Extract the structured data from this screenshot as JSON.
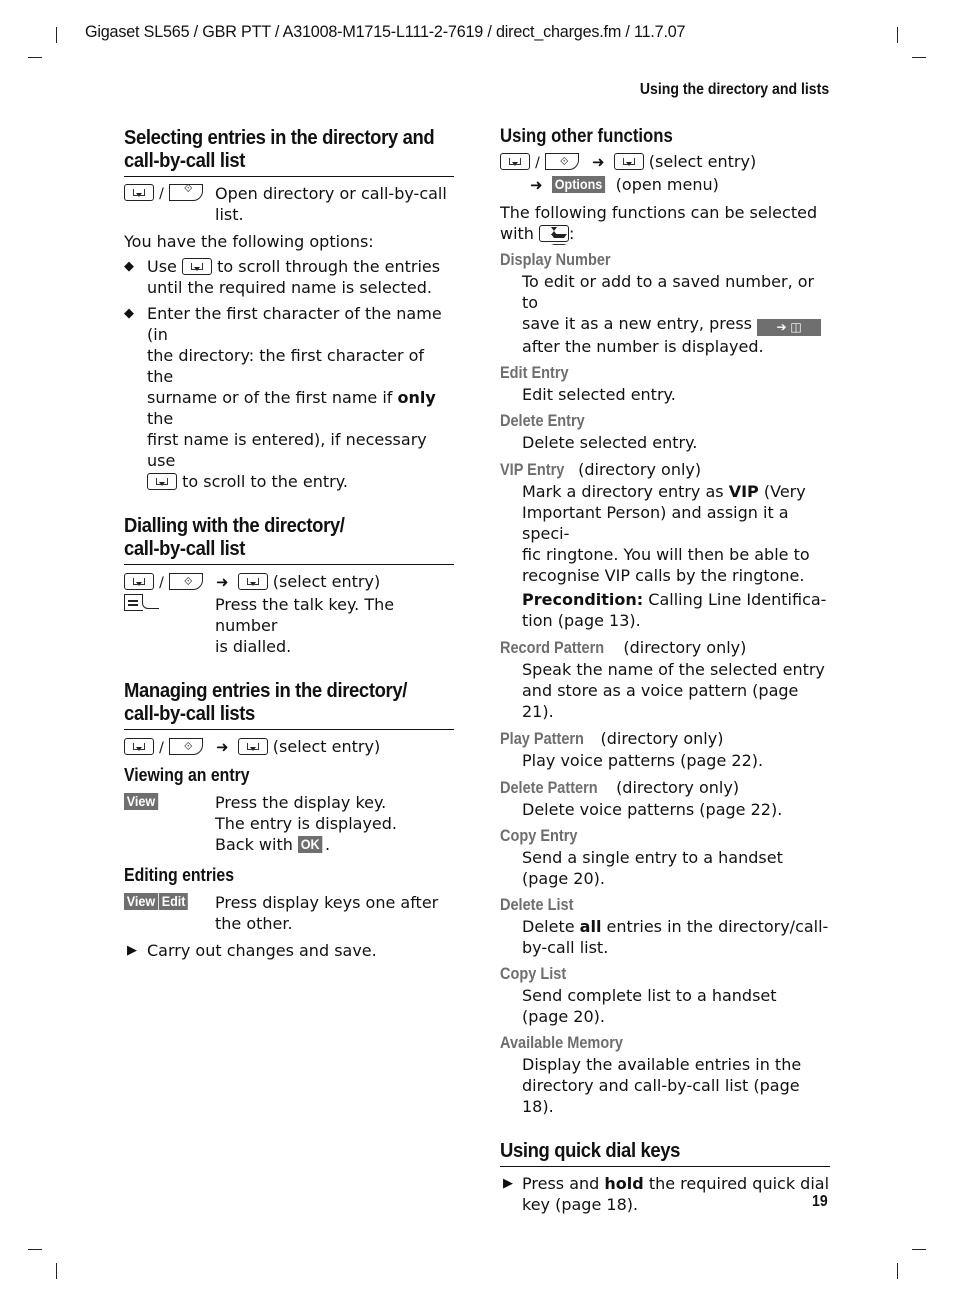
{
  "header": {
    "file_info": "Gigaset SL565 / GBR PTT / A31008-M1715-L111-2-7619 / direct_charges.fm / 11.7.07",
    "running_head": "Using the directory and lists"
  },
  "footer": {
    "page_number": "19"
  },
  "left": {
    "select": {
      "title_l1": "Selecting entries in the directory and",
      "title_l2": "call-by-call list",
      "key_sep": "/",
      "open_desc_l1": "Open directory or call-by-call",
      "open_desc_l2": "list.",
      "intro": "You have the following options:",
      "bullet1_a": "Use",
      "bullet1_b": "to scroll through the entries",
      "bullet1_c": "until the required name is selected.",
      "bullet2_l1": "Enter the first character of the name (in",
      "bullet2_l2": "the directory: the first character of the",
      "bullet2_l3a": "surname or of the first name if",
      "bullet2_l3b": "only",
      "bullet2_l3c": "the",
      "bullet2_l4": "first name is entered), if necessary use",
      "bullet2_l5": "to scroll to the entry."
    },
    "dial": {
      "title_l1": "Dialling with the directory/",
      "title_l2": "call-by-call list",
      "key_sep": "/",
      "select_entry": "(select entry)",
      "talk_l1": "Press the talk key. The number",
      "talk_l2": "is dialled."
    },
    "manage": {
      "title_l1": "Managing entries in the directory/",
      "title_l2": "call-by-call lists",
      "key_sep": "/",
      "select_entry": "(select entry)",
      "view_title": "Viewing an entry",
      "view_key": "View",
      "view_l1": "Press the display key.",
      "view_l2": "The entry is displayed.",
      "view_l3": "Back with",
      "ok_key": "OK",
      "view_l3_end": ".",
      "edit_title": "Editing entries",
      "edit_key1": "View",
      "edit_key2": "Edit",
      "edit_l1": "Press display keys one after",
      "edit_l2": "the other.",
      "step": "Carry out changes and save."
    }
  },
  "right": {
    "other": {
      "title": "Using other functions",
      "key_sep": "/",
      "select_entry": "(select entry)",
      "options_key": "Options",
      "open_menu": "(open menu)",
      "intro_l1": "The following functions can be selected",
      "intro_l2": "with",
      "intro_end": ":",
      "save_key_glyph": "➔ ◫"
    },
    "functions": [
      {
        "name": "Display Number",
        "note": "",
        "lines": [
          "To edit or add to a saved number, or to",
          "save it as a new entry, press",
          "after the number is displayed."
        ]
      },
      {
        "name": "Edit Entry",
        "note": "",
        "lines": [
          "Edit selected entry."
        ]
      },
      {
        "name": "Delete Entry",
        "note": "",
        "lines": [
          "Delete selected entry."
        ]
      },
      {
        "name": "VIP Entry",
        "note": " (directory only)",
        "lines": [
          "Mark a directory entry as",
          "VIP",
          "(Very",
          "Important Person) and assign it a speci-",
          "fic ringtone. You will then be able to",
          "recognise VIP calls by the ringtone."
        ],
        "precondition_label": "Precondition:",
        "precondition_l1": "Calling Line Identifica-",
        "precondition_l2": "tion (page 13)."
      },
      {
        "name": "Record Pattern",
        "note": "(directory only)",
        "lines": [
          "Speak the name of the selected entry",
          "and store as a voice pattern (page 21)."
        ]
      },
      {
        "name": "Play Pattern",
        "note": "(directory only)",
        "lines": [
          "Play voice patterns (page 22)."
        ]
      },
      {
        "name": "Delete Pattern",
        "note": "(directory only)",
        "lines": [
          "Delete voice patterns (page 22)."
        ]
      },
      {
        "name": "Copy Entry",
        "note": "",
        "lines": [
          "Send a single entry to a handset",
          "(page 20)."
        ]
      },
      {
        "name": "Delete List",
        "note": "",
        "lines": [
          "Delete",
          "all",
          "entries in the directory/call-",
          "by-call list."
        ]
      },
      {
        "name": "Copy List",
        "note": "",
        "lines": [
          "Send complete list to a handset",
          "(page 20)."
        ]
      },
      {
        "name": "Available Memory",
        "note": "",
        "lines": [
          "Display the available entries in the",
          "directory and call-by-call list (page 18)."
        ]
      }
    ],
    "quick": {
      "title": "Using quick dial keys",
      "step_a": "Press and",
      "step_b": "hold",
      "step_c": "the required quick dial",
      "step_l2": "key (page 18)."
    }
  }
}
